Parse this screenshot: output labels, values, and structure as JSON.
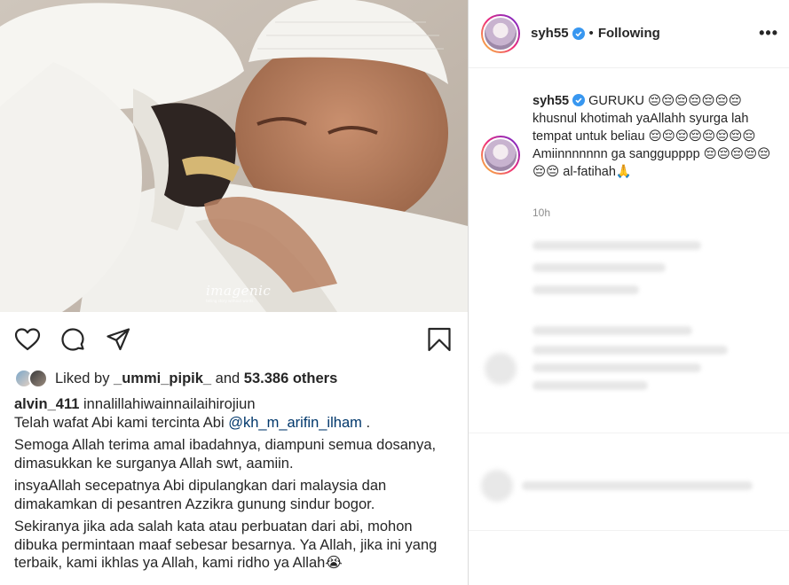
{
  "post": {
    "image_watermark": "imagenic",
    "image_watermark_sub": "telling story without words",
    "actions": {
      "like_icon": "heart-icon",
      "comment_icon": "comment-icon",
      "share_icon": "share-icon",
      "save_icon": "bookmark-icon"
    },
    "likes": {
      "prefix": "Liked by ",
      "user": "_ummi_pipik_",
      "middle": " and ",
      "count": "53.386 others"
    },
    "caption": {
      "username": "alvin_411",
      "line1": "innalillahiwainnailaihirojiun",
      "line2_prefix": "Telah wafat Abi kami tercinta Abi ",
      "line2_mention": "@kh_m_arifin_ilham",
      "line2_suffix": " .",
      "para2": "Semoga Allah terima amal ibadahnya, diampuni semua dosanya, dimasukkan ke surganya Allah swt, aamiin.",
      "para3": "insyaAllah secepatnya Abi dipulangkan dari malaysia dan dimakamkan di pesantren Azzikra gunung sindur bogor.",
      "para4": "Sekiranya jika ada salah kata atau perbuatan dari abi, mohon dibuka permintaan maaf sebesar besarnya. Ya Allah, jika ini yang terbaik, kami ikhlas ya Allah, kami ridho ya Allah😭"
    }
  },
  "sidebar": {
    "header": {
      "username": "syh55",
      "dot": "•",
      "follow_label": "Following",
      "more_label": "•••"
    },
    "comment": {
      "username": "syh55",
      "text": " GURUKU 😔😔😔😔😔😔😔 khusnul khotimah yaAllahh syurga lah tempat untuk beliau 😔😔😔😔😔😔😔😔 Amiinnnnnnn ga sanggupppp 😔😔😔😔😔😔😔 al-fatihah🙏",
      "time": "10h"
    }
  },
  "colors": {
    "mention": "#00376b",
    "verified": "#3897f0",
    "muted": "#8e8e8e",
    "border": "#dbdbdb"
  }
}
